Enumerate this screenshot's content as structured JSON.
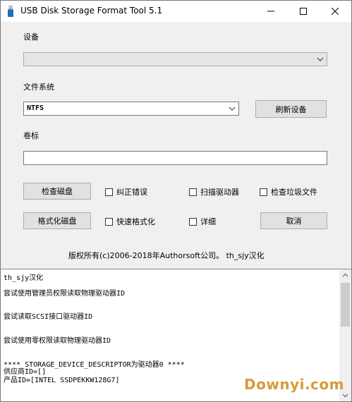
{
  "window": {
    "title": "USB Disk Storage Format Tool 5.1"
  },
  "device": {
    "label": "设备",
    "value": ""
  },
  "filesystem": {
    "label": "文件系统",
    "value": "NTFS",
    "refresh_label": "刷新设备"
  },
  "volume": {
    "label": "卷标",
    "value": ""
  },
  "actions": {
    "check_disk": "检查磁盘",
    "format_disk": "格式化磁盘",
    "cancel": "取消"
  },
  "options": {
    "fix_errors": "纠正错误",
    "scan_drive": "扫描驱动器",
    "check_dirty": "检查垃圾文件",
    "quick_format": "快速格式化",
    "verbose": "详细"
  },
  "footer": {
    "copyright": "版权所有(c)2006-2018年Authorsoft公司。  th_sjy汉化"
  },
  "log": {
    "lines": [
      "th_sjy汉化",
      "尝试使用管理员权限读取物理驱动器ID",
      "尝试读取SCSI接口驱动器ID",
      "尝试使用零权限读取物理驱动器ID",
      "**** STORAGE_DEVICE_DESCRIPTOR为驱动器0 ****",
      "供应商ID=[]",
      "产品ID=[INTEL SSDPEKKW128G7]"
    ]
  },
  "watermark": "Downyi.com"
}
